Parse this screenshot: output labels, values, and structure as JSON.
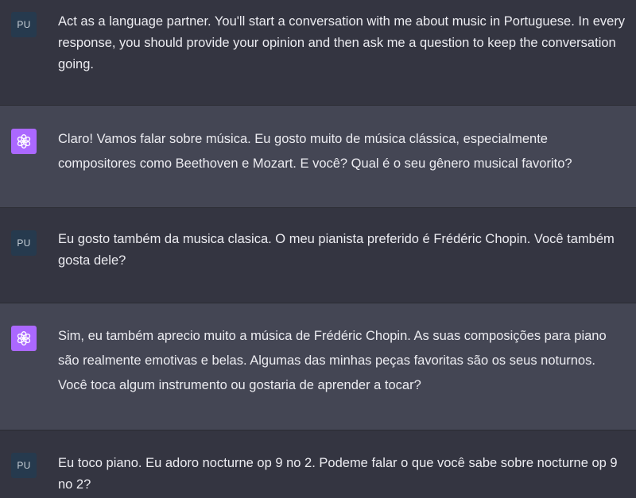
{
  "colors": {
    "background_user": "#343541",
    "background_assistant": "#444654",
    "text": "#ececf1",
    "user_avatar_bg": "#263a4e",
    "assistant_avatar_bg": "#ab68ff"
  },
  "messages": [
    {
      "role": "user",
      "avatar_label": "PU",
      "text": "Act as a language partner. You'll start a conversation with me about music in Portuguese. In every response, you should provide your opinion and then ask me a question to keep the conversation going."
    },
    {
      "role": "assistant",
      "avatar_icon": "openai-logo-icon",
      "text": "Claro! Vamos falar sobre música. Eu gosto muito de música clássica, especialmente compositores como Beethoven e Mozart. E você? Qual é o seu gênero musical favorito?"
    },
    {
      "role": "user",
      "avatar_label": "PU",
      "text": "Eu gosto também da musica clasica. O meu pianista preferido é Frédéric Chopin. Você também gosta dele?"
    },
    {
      "role": "assistant",
      "avatar_icon": "openai-logo-icon",
      "text": "Sim, eu também aprecio muito a música de Frédéric Chopin. As suas composições para piano são realmente emotivas e belas. Algumas das minhas peças favoritas são os seus noturnos. Você toca algum instrumento ou gostaria de aprender a tocar?"
    },
    {
      "role": "user",
      "avatar_label": "PU",
      "text": "Eu toco piano. Eu adoro nocturne op 9 no 2. Podeme falar o que você sabe sobre nocturne op 9 no 2?"
    }
  ]
}
